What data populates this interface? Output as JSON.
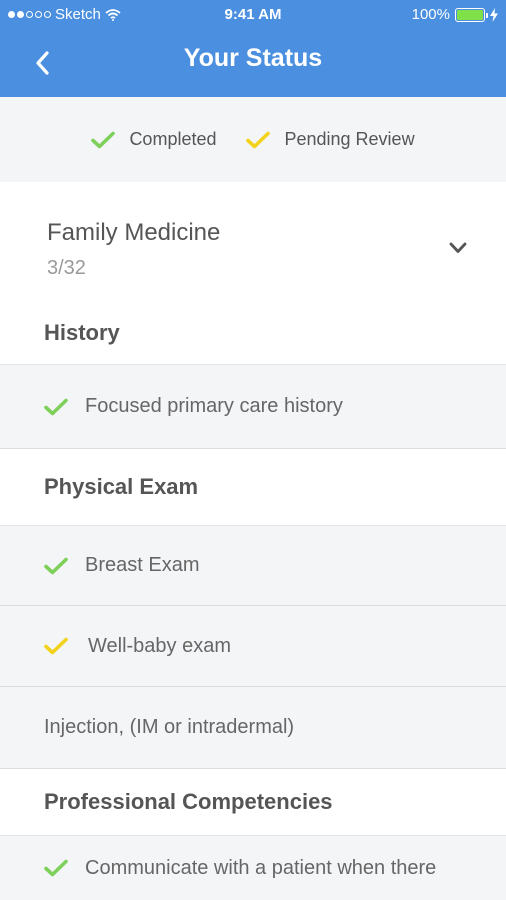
{
  "status_bar": {
    "carrier": "Sketch",
    "time": "9:41 AM",
    "battery": "100%"
  },
  "nav": {
    "title": "Your Status"
  },
  "legend": {
    "completed_label": "Completed",
    "pending_label": "Pending Review"
  },
  "colors": {
    "header": "#4a8fe0",
    "completed": "#7dd05a",
    "pending": "#f2d21b"
  },
  "course": {
    "name": "Family Medicine",
    "progress": "3/32"
  },
  "sections": [
    {
      "title": "History",
      "items": [
        {
          "label": "Focused primary care history",
          "status": "completed"
        }
      ]
    },
    {
      "title": "Physical Exam",
      "items": [
        {
          "label": "Breast Exam",
          "status": "completed"
        },
        {
          "label": "Well-baby exam",
          "status": "pending"
        },
        {
          "label": "Injection, (IM or intradermal)",
          "status": "none"
        }
      ]
    },
    {
      "title": "Professional Competencies",
      "items": [
        {
          "label": "Communicate with a patient when there",
          "status": "completed"
        }
      ]
    }
  ]
}
